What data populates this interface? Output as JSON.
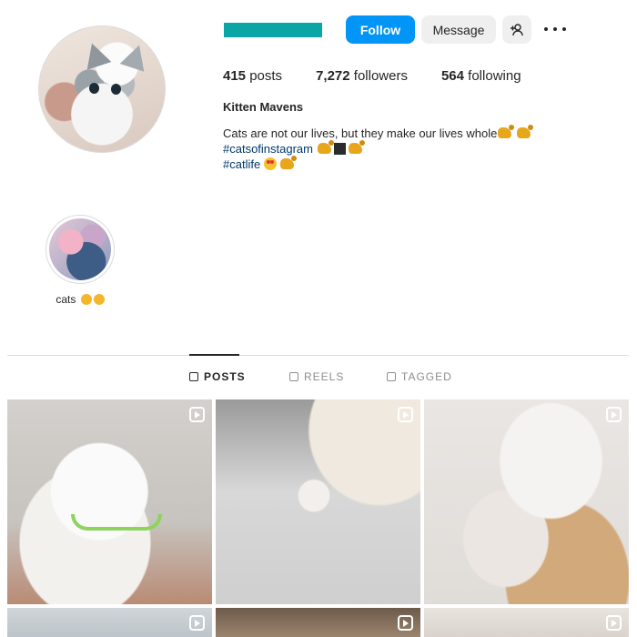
{
  "profile": {
    "username_hidden_color": "#0aa5a5",
    "follow_label": "Follow",
    "message_label": "Message",
    "add_user_icon": "person-add-icon",
    "more_icon": "more-horizontal-icon",
    "stats": {
      "posts_count": "415",
      "posts_label": "posts",
      "followers_count": "7,272",
      "followers_label": "followers",
      "following_count": "564",
      "following_label": "following"
    },
    "full_name": "Kitten Mavens",
    "bio_line1": "Cats are not our lives, but they make our lives whole",
    "bio_hashtag1": "#catsofinstagram",
    "bio_hashtag2": "#catlife"
  },
  "highlights": [
    {
      "label": "cats"
    }
  ],
  "tabs": {
    "posts": "POSTS",
    "reels": "REELS",
    "tagged": "TAGGED",
    "active": "posts"
  },
  "grid": {
    "post_count_visible": 6,
    "reel_icon": "reel-icon"
  },
  "colors": {
    "primary_button": "#0095f6",
    "secondary_button": "#efefef",
    "hashtag": "#00376b",
    "divider": "#dbdbdb"
  }
}
